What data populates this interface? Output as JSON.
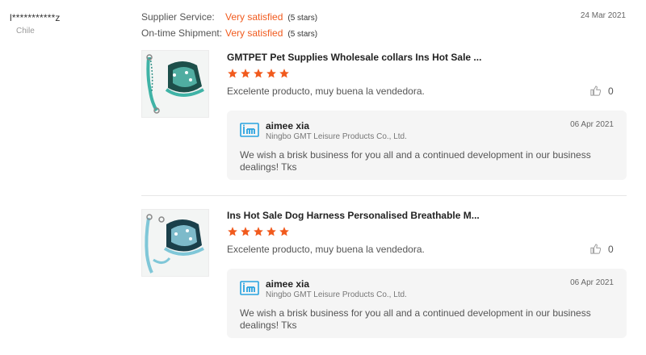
{
  "buyer": {
    "name": "l***********z",
    "country": "Chile"
  },
  "ratings": {
    "supplier_service": {
      "label": "Supplier Service:",
      "value": "Very satisfied",
      "stars_text": "(5 stars)"
    },
    "ontime_shipment": {
      "label": "On-time Shipment:",
      "value": "Very satisfied",
      "stars_text": "(5 stars)"
    }
  },
  "review_date": "24 Mar 2021",
  "colors": {
    "accent": "#f15a1d",
    "star": "#f15a1d",
    "reply_bg": "#f5f5f5",
    "logo": "#2aa3e0"
  },
  "reviews": [
    {
      "product_title": "GMTPET Pet Supplies Wholesale collars Ins Hot Sale ...",
      "stars": 5,
      "text": "Excelente producto, muy buena la vendedora.",
      "likes": "0",
      "reply": {
        "name": "aimee xia",
        "company": "Ningbo GMT Leisure Products Co., Ltd.",
        "date": "06 Apr 2021",
        "message": "We wish a brisk business for you all and a continued development in our business dealings! Tks"
      }
    },
    {
      "product_title": "Ins Hot Sale Dog Harness Personalised Breathable M...",
      "stars": 5,
      "text": "Excelente producto, muy buena la vendedora.",
      "likes": "0",
      "reply": {
        "name": "aimee xia",
        "company": "Ningbo GMT Leisure Products Co., Ltd.",
        "date": "06 Apr 2021",
        "message": "We wish a brisk business for you all and a continued development in our business dealings! Tks"
      }
    }
  ]
}
